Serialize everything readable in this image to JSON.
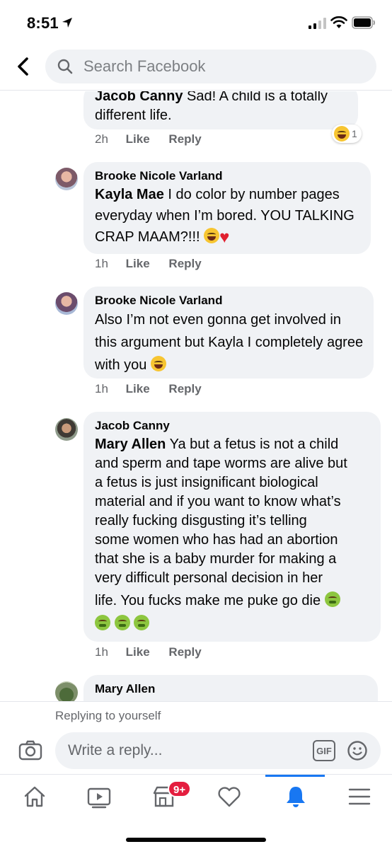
{
  "status_bar": {
    "time": "8:51"
  },
  "header": {
    "search_placeholder": "Search Facebook"
  },
  "comments": [
    {
      "author": "",
      "mention": "Jacob Canny",
      "text": "Sad! A child is a totally different life.",
      "time": "2h",
      "like_label": "Like",
      "reply_label": "Reply",
      "reaction_count": "1"
    },
    {
      "author": "Brooke Nicole Varland",
      "mention": "Kayla Mae",
      "text": "I do color by number pages everyday when I’m bored. YOU TALKING CRAP MAAM?!!!",
      "time": "1h",
      "like_label": "Like",
      "reply_label": "Reply"
    },
    {
      "author": "Brooke Nicole Varland",
      "mention": "",
      "text": "Also I’m not even gonna get involved in this argument but Kayla I completely agree with you",
      "time": "1h",
      "like_label": "Like",
      "reply_label": "Reply"
    },
    {
      "author": "Jacob Canny",
      "mention": "Mary Allen",
      "text_lines": [
        "Ya but a fetus is not a child",
        "and sperm and tape worms are alive but",
        "a fetus is just insignificant biological",
        "material and if you want to know what’s",
        "really fucking disgusting it’s telling",
        "some women who has had an abortion",
        "that she is a baby murder for making a",
        "very difficult personal decision in her",
        "life. You fucks make me puke go die"
      ],
      "time": "1h",
      "like_label": "Like",
      "reply_label": "Reply"
    },
    {
      "author": "Mary Allen"
    }
  ],
  "reply_bar": {
    "replying_label": "Replying to yourself",
    "placeholder": "Write a reply...",
    "gif_label": "GIF"
  },
  "tab_bar": {
    "marketplace_badge": "9+",
    "active_tab": "notifications"
  },
  "colors": {
    "accent": "#1877f2",
    "bubble": "#f0f2f5",
    "badge": "#e41e3f",
    "meta_text": "#65676b"
  }
}
